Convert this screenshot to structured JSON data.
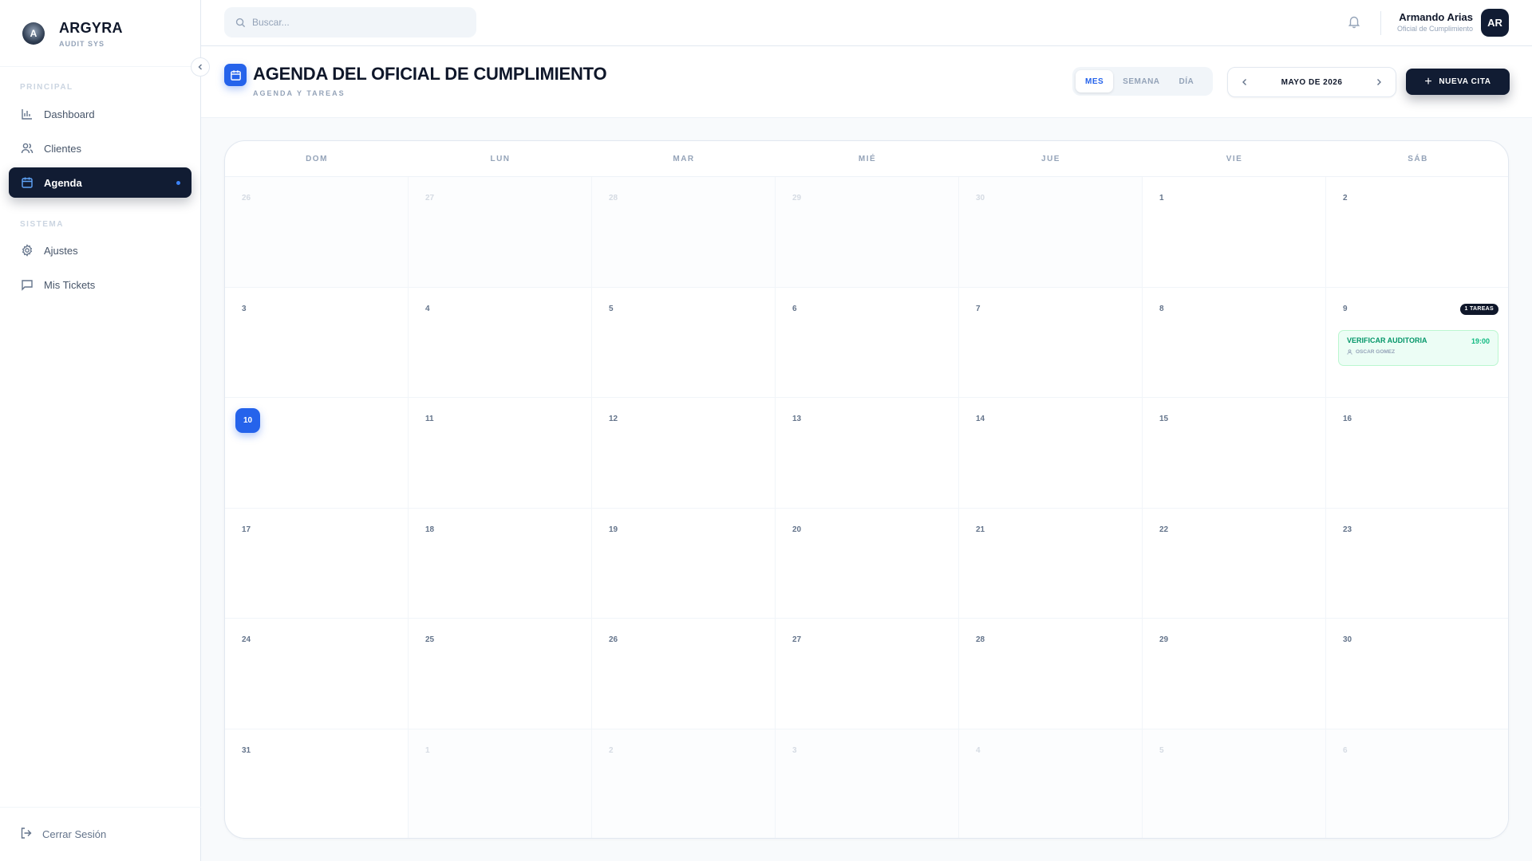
{
  "brand": {
    "name": "ARGYRA",
    "subtitle": "AUDIT SYS",
    "logo_letter": "A"
  },
  "sidebar": {
    "section_principal": "PRINCIPAL",
    "section_sistema": "SISTEMA",
    "items": [
      {
        "label": "Dashboard",
        "icon": "bar-chart-icon"
      },
      {
        "label": "Clientes",
        "icon": "users-icon"
      },
      {
        "label": "Agenda",
        "icon": "calendar-icon",
        "active": true
      },
      {
        "label": "Ajustes",
        "icon": "gear-icon"
      },
      {
        "label": "Mis Tickets",
        "icon": "message-square-icon"
      }
    ],
    "logout_label": "Cerrar Sesión"
  },
  "topbar": {
    "search_placeholder": "Buscar...",
    "user_name": "Armando Arias",
    "user_role": "Oficial de Cumplimiento",
    "avatar_initials": "AR"
  },
  "header": {
    "title": "AGENDA DEL OFICIAL DE CUMPLIMIENTO",
    "subtitle": "AGENDA Y TAREAS",
    "views": [
      "MES",
      "SEMANA",
      "DÍA"
    ],
    "active_view": "MES",
    "month_label": "MAYO DE 2026",
    "new_button_label": "NUEVA CITA"
  },
  "calendar": {
    "weekdays": [
      "DOM",
      "LUN",
      "MAR",
      "MIÉ",
      "JUE",
      "VIE",
      "SÁB"
    ],
    "days": [
      {
        "n": "26",
        "dim": true
      },
      {
        "n": "27",
        "dim": true
      },
      {
        "n": "28",
        "dim": true
      },
      {
        "n": "29",
        "dim": true
      },
      {
        "n": "30",
        "dim": true
      },
      {
        "n": "1"
      },
      {
        "n": "2"
      },
      {
        "n": "3"
      },
      {
        "n": "4"
      },
      {
        "n": "5"
      },
      {
        "n": "6"
      },
      {
        "n": "7"
      },
      {
        "n": "8"
      },
      {
        "n": "9",
        "badge": "1 TAREAS",
        "event": {
          "title": "VERIFICAR AUDITORIA",
          "time": "19:00",
          "person": "OSCAR GOMEZ"
        }
      },
      {
        "n": "10",
        "today": true
      },
      {
        "n": "11"
      },
      {
        "n": "12"
      },
      {
        "n": "13"
      },
      {
        "n": "14"
      },
      {
        "n": "15"
      },
      {
        "n": "16"
      },
      {
        "n": "17"
      },
      {
        "n": "18"
      },
      {
        "n": "19"
      },
      {
        "n": "20"
      },
      {
        "n": "21"
      },
      {
        "n": "22"
      },
      {
        "n": "23"
      },
      {
        "n": "24"
      },
      {
        "n": "25"
      },
      {
        "n": "26"
      },
      {
        "n": "27"
      },
      {
        "n": "28"
      },
      {
        "n": "29"
      },
      {
        "n": "30"
      },
      {
        "n": "31"
      },
      {
        "n": "1",
        "dim": true
      },
      {
        "n": "2",
        "dim": true
      },
      {
        "n": "3",
        "dim": true
      },
      {
        "n": "4",
        "dim": true
      },
      {
        "n": "5",
        "dim": true
      },
      {
        "n": "6",
        "dim": true
      }
    ]
  },
  "colors": {
    "accent": "#2563eb",
    "navy": "#111c33",
    "event_green": "#059669"
  }
}
